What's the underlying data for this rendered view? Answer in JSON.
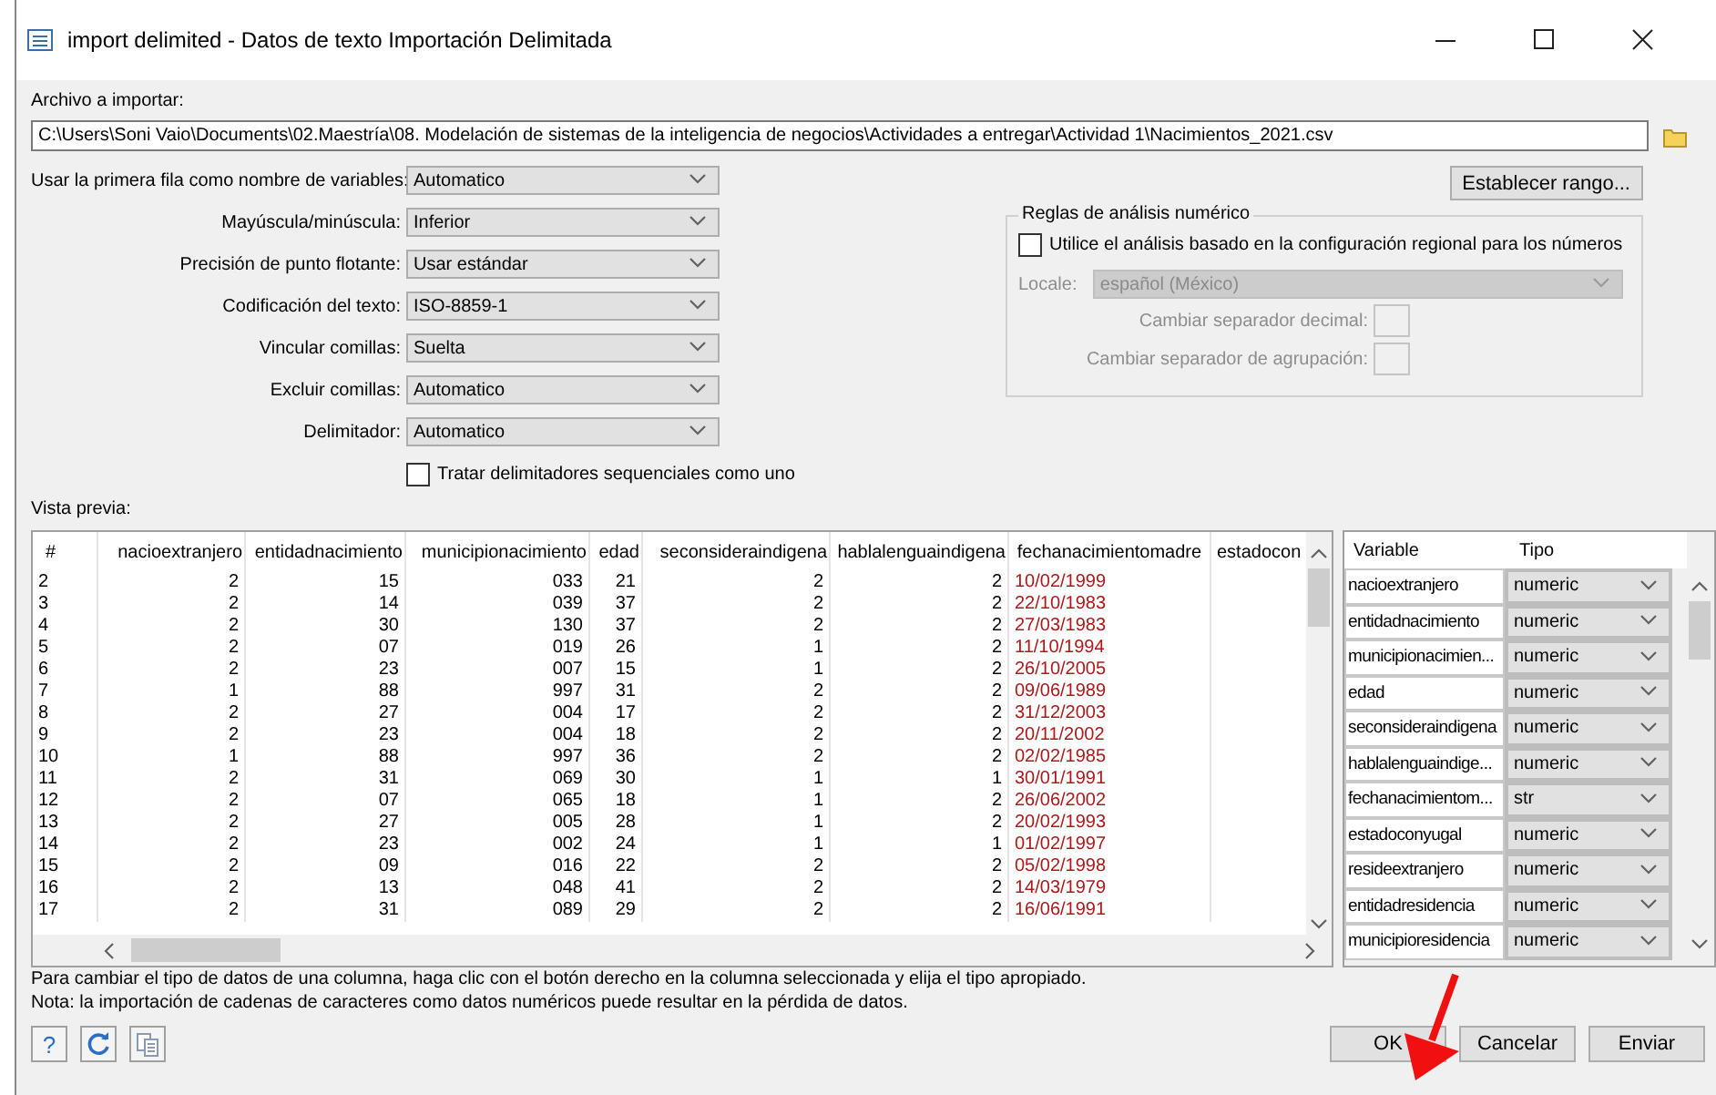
{
  "window": {
    "title": "import delimited - Datos de texto Importación Delimitada"
  },
  "file": {
    "label": "Archivo a importar:",
    "value": "C:\\Users\\Soni Vaio\\Documents\\02.Maestría\\08. Modelación de sistemas de la inteligencia de negocios\\Actividades a entregar\\Actividad 1\\Nacimientos_2021.csv"
  },
  "range_button": "Establecer rango...",
  "options": [
    {
      "label": "Usar la primera fila como nombre de variables:",
      "value": "Automatico"
    },
    {
      "label": "Mayúscula/minúscula:",
      "value": "Inferior"
    },
    {
      "label": "Precisión de punto flotante:",
      "value": "Usar estándar"
    },
    {
      "label": "Codificación del texto:",
      "value": "ISO-8859-1"
    },
    {
      "label": "Vincular comillas:",
      "value": "Suelta"
    },
    {
      "label": "Excluir comillas:",
      "value": "Automatico"
    },
    {
      "label": "Delimitador:",
      "value": "Automatico"
    }
  ],
  "sequential_checkbox": {
    "label": "Tratar delimitadores sequenciales como uno",
    "checked": false
  },
  "numeric_rules": {
    "title": "Reglas de análisis numérico",
    "regional": {
      "label": "Utilice el análisis basado en la configuración regional para los números",
      "checked": false
    },
    "locale": {
      "label": "Locale:",
      "value": "español (México)",
      "disabled": true
    },
    "separators": [
      {
        "label": "Cambiar separador decimal:",
        "disabled": true
      },
      {
        "label": "Cambiar separador de agrupación:",
        "disabled": true
      }
    ]
  },
  "preview": {
    "label": "Vista previa:",
    "columns": [
      {
        "label": "#",
        "kind": "index"
      },
      {
        "label": "nacioextranjero",
        "kind": "number"
      },
      {
        "label": "entidadnacimiento",
        "kind": "number"
      },
      {
        "label": "municipionacimiento",
        "kind": "number"
      },
      {
        "label": "edad",
        "kind": "number"
      },
      {
        "label": "seconsideraindigena",
        "kind": "number"
      },
      {
        "label": "hablalenguaindigena",
        "kind": "number"
      },
      {
        "label": "fechanacimientomadre",
        "kind": "string"
      },
      {
        "label": "estadocon",
        "kind": "number"
      }
    ],
    "rows": [
      [
        "2",
        "2",
        "15",
        "033",
        "21",
        "2",
        "2",
        "10/02/1999"
      ],
      [
        "3",
        "2",
        "14",
        "039",
        "37",
        "2",
        "2",
        "22/10/1983"
      ],
      [
        "4",
        "2",
        "30",
        "130",
        "37",
        "2",
        "2",
        "27/03/1983"
      ],
      [
        "5",
        "2",
        "07",
        "019",
        "26",
        "1",
        "2",
        "11/10/1994"
      ],
      [
        "6",
        "2",
        "23",
        "007",
        "15",
        "1",
        "2",
        "26/10/2005"
      ],
      [
        "7",
        "1",
        "88",
        "997",
        "31",
        "2",
        "2",
        "09/06/1989"
      ],
      [
        "8",
        "2",
        "27",
        "004",
        "17",
        "2",
        "2",
        "31/12/2003"
      ],
      [
        "9",
        "2",
        "23",
        "004",
        "18",
        "2",
        "2",
        "20/11/2002"
      ],
      [
        "10",
        "1",
        "88",
        "997",
        "36",
        "2",
        "2",
        "02/02/1985"
      ],
      [
        "11",
        "2",
        "31",
        "069",
        "30",
        "1",
        "1",
        "30/01/1991"
      ],
      [
        "12",
        "2",
        "07",
        "065",
        "18",
        "1",
        "2",
        "26/06/2002"
      ],
      [
        "13",
        "2",
        "27",
        "005",
        "28",
        "1",
        "2",
        "20/02/1993"
      ],
      [
        "14",
        "2",
        "23",
        "002",
        "24",
        "1",
        "1",
        "01/02/1997"
      ],
      [
        "15",
        "2",
        "09",
        "016",
        "22",
        "2",
        "2",
        "05/02/1998"
      ],
      [
        "16",
        "2",
        "13",
        "048",
        "41",
        "2",
        "2",
        "14/03/1979"
      ],
      [
        "17",
        "2",
        "31",
        "089",
        "29",
        "2",
        "2",
        "16/06/1991"
      ]
    ]
  },
  "variables": {
    "columns": [
      "Variable",
      "Tipo"
    ],
    "rows": [
      {
        "name": "nacioextranjero",
        "type": "numeric"
      },
      {
        "name": "entidadnacimiento",
        "type": "numeric"
      },
      {
        "name": "municipionacimien...",
        "type": "numeric"
      },
      {
        "name": "edad",
        "type": "numeric"
      },
      {
        "name": "seconsideraindigena",
        "type": "numeric"
      },
      {
        "name": "hablalenguaindige...",
        "type": "numeric"
      },
      {
        "name": "fechanacimientom...",
        "type": "str"
      },
      {
        "name": "estadoconyugal",
        "type": "numeric"
      },
      {
        "name": "resideextranjero",
        "type": "numeric"
      },
      {
        "name": "entidadresidencia",
        "type": "numeric"
      },
      {
        "name": "municipioresidencia",
        "type": "numeric"
      }
    ]
  },
  "notes": [
    "Para cambiar el tipo de datos de una columna, haga clic con el botón derecho en la columna seleccionada y elija el tipo apropiado.",
    "Nota: la importación de cadenas de caracteres como datos numéricos puede resultar en la pérdida de datos."
  ],
  "tools": [
    {
      "kind": "help",
      "label": "?"
    },
    {
      "kind": "refresh"
    },
    {
      "kind": "copy"
    }
  ],
  "buttons": [
    "OK",
    "Cancelar",
    "Enviar"
  ]
}
